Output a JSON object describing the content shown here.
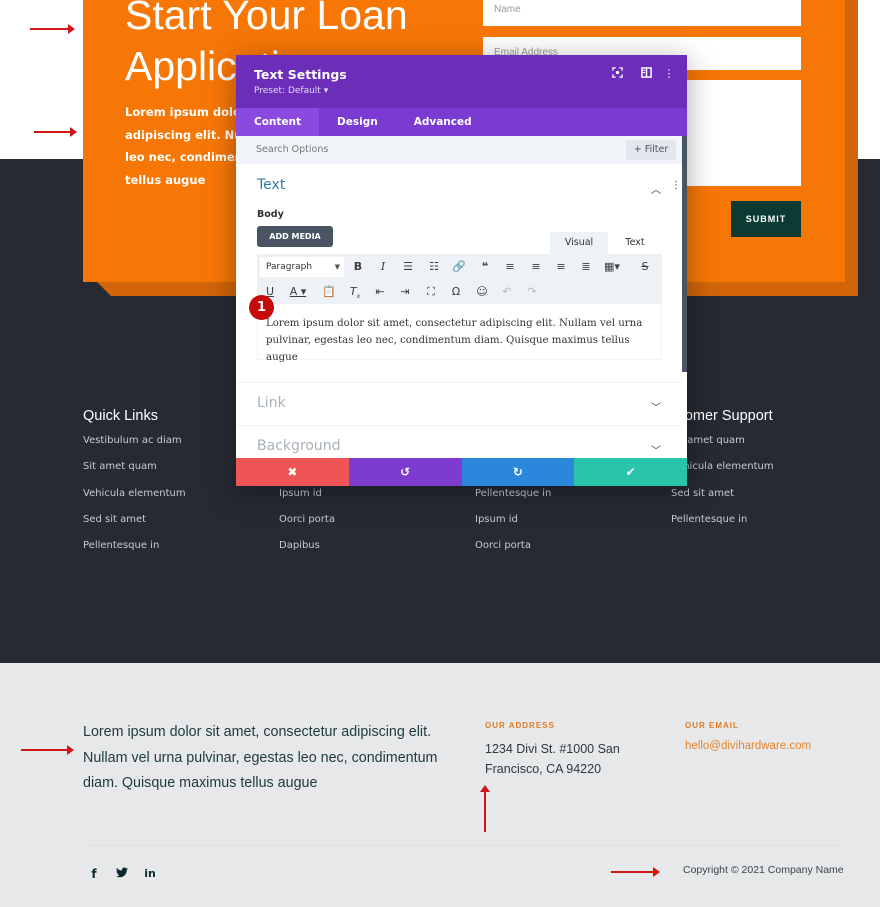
{
  "hero": {
    "title": "Start Your Loan Application",
    "text": "Lorem ipsum dolor sit amet, consectetur adipiscing elit. Nullam vel urna pulvinar, egestas leo nec, condimentum diam. Quisque maximus tellus augue",
    "form": {
      "name_placeholder": "Name",
      "email_placeholder": "Email Address",
      "message_placeholder": "",
      "submit_label": "SUBMIT"
    }
  },
  "modal": {
    "title": "Text Settings",
    "preset": "Preset: Default ▾",
    "header_icons": [
      "focus-icon",
      "split-view-icon",
      "more-options-icon"
    ],
    "tabs": [
      {
        "label": "Content",
        "active": true
      },
      {
        "label": "Design",
        "active": false
      },
      {
        "label": "Advanced",
        "active": false
      }
    ],
    "search_placeholder": "Search Options",
    "filter_label": "+ Filter",
    "sections": {
      "text": {
        "label": "Text",
        "expanded": true
      },
      "link": {
        "label": "Link",
        "expanded": false
      },
      "background": {
        "label": "Background",
        "expanded": false
      }
    },
    "body_label": "Body",
    "add_media_label": "ADD MEDIA",
    "editor_tabs": {
      "visual": "Visual",
      "text": "Text"
    },
    "format_select": "Paragraph",
    "editor_content": "Lorem ipsum dolor sit amet, consectetur adipiscing elit. Nullam vel urna pulvinar, egestas leo nec, condimentum diam. Quisque maximus tellus augue",
    "step_badge": "1",
    "actions": {
      "cancel": {
        "icon": "✖",
        "color": "#ef5555"
      },
      "undo": {
        "icon": "↺",
        "color": "#7e3bd0"
      },
      "redo": {
        "icon": "↻",
        "color": "#2b87da"
      },
      "save": {
        "icon": "✔",
        "color": "#29c4a9"
      }
    }
  },
  "footer_columns": [
    {
      "title": "Quick Links",
      "links": [
        "Vestibulum ac diam",
        "Sit amet quam",
        "Vehicula elementum",
        "Sed sit amet",
        "Pellentesque in"
      ]
    },
    {
      "title": "",
      "links": [
        "",
        "",
        "Ipsum id",
        "Oorci porta",
        "Dapibus"
      ]
    },
    {
      "title": "",
      "links": [
        "",
        "",
        "Pellentesque in",
        "Ipsum id",
        "Oorci porta"
      ]
    },
    {
      "title": "Customer Support",
      "links": [
        "Sit amet quam",
        "Vehicula elementum",
        "Sed sit amet",
        "Pellentesque in"
      ]
    }
  ],
  "bottom_footer": {
    "text": "Lorem ipsum dolor sit amet, consectetur adipiscing elit. Nullam vel urna pulvinar, egestas leo nec, condimentum diam. Quisque maximus tellus augue",
    "address_label": "OUR ADDRESS",
    "address": "1234 Divi St. #1000 San Francisco, CA 94220",
    "email_label": "OUR EMAIL",
    "email": "hello@divihardware.com",
    "social": [
      {
        "name": "facebook",
        "glyph": "f"
      },
      {
        "name": "twitter",
        "glyph": "🐦"
      },
      {
        "name": "linkedin",
        "glyph": "in"
      }
    ],
    "copyright": "Copyright © 2021 Company Name"
  },
  "colors": {
    "orange": "#f77706",
    "purple": "#6c2eb9",
    "dark_bg": "#252a33",
    "submit": "#0b3b33",
    "annotation_red": "#d01616"
  }
}
